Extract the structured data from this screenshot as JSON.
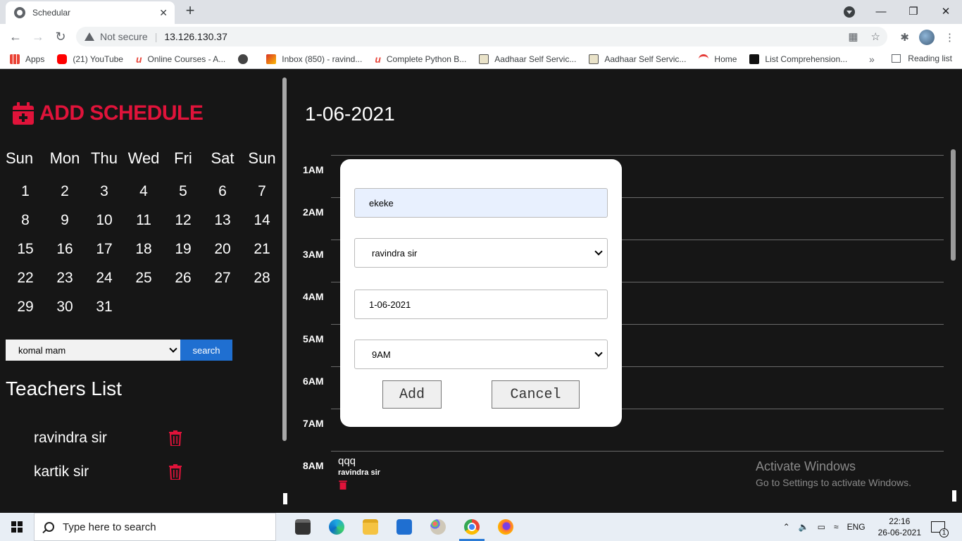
{
  "browser": {
    "tab_title": "Schedular",
    "not_secure": "Not secure",
    "url": "13.126.130.37",
    "bookmarks": [
      {
        "label": "Apps",
        "color": "#4285f4"
      },
      {
        "label": "(21) YouTube",
        "color": "#ff0000"
      },
      {
        "label": "Online Courses - A...",
        "color": "#e8473c"
      },
      {
        "label": "",
        "color": "#444444"
      },
      {
        "label": "Inbox (850) - ravind...",
        "color": "#d93025"
      },
      {
        "label": "Complete Python B...",
        "color": "#e8473c"
      },
      {
        "label": "Aadhaar Self Servic...",
        "color": "#7a6a4a"
      },
      {
        "label": "Aadhaar Self Servic...",
        "color": "#7a6a4a"
      },
      {
        "label": "Home",
        "color": "#e53935"
      },
      {
        "label": "List Comprehension...",
        "color": "#111111"
      }
    ],
    "more_bookmarks": "»",
    "reading_list": "Reading list"
  },
  "sidebar": {
    "title": "ADD SCHEDULE",
    "weekdays": [
      "Sun",
      "Mon",
      "Thu",
      "Wed",
      "Fri",
      "Sat",
      "Sun"
    ],
    "days": [
      "1",
      "2",
      "3",
      "4",
      "5",
      "6",
      "7",
      "8",
      "9",
      "10",
      "11",
      "12",
      "13",
      "14",
      "15",
      "16",
      "17",
      "18",
      "19",
      "20",
      "21",
      "22",
      "23",
      "24",
      "25",
      "26",
      "27",
      "28",
      "29",
      "30",
      "31"
    ],
    "teacher_select_value": "komal mam",
    "search_label": "search",
    "teachers_title": "Teachers List",
    "teachers": [
      "ravindra sir",
      "kartik sir"
    ]
  },
  "main": {
    "date": "1-06-2021",
    "hours": [
      "1AM",
      "2AM",
      "3AM",
      "4AM",
      "5AM",
      "6AM",
      "7AM",
      "8AM"
    ],
    "event": {
      "title": "qqq",
      "teacher": "ravindra sir"
    },
    "activate_title": "Activate Windows",
    "activate_sub": "Go to Settings to activate Windows."
  },
  "modal": {
    "name_value": "ekeke",
    "teacher_value": "ravindra sir",
    "date_value": "1-06-2021",
    "time_value": "9AM",
    "add_label": "Add",
    "cancel_label": "Cancel"
  },
  "taskbar": {
    "search_placeholder": "Type here to search",
    "language": "ENG",
    "time": "22:16",
    "date": "26-06-2021",
    "notification_count": "1"
  },
  "colors": {
    "accent": "#e0133a",
    "search_button": "#1f6fd1",
    "background": "#161616"
  }
}
